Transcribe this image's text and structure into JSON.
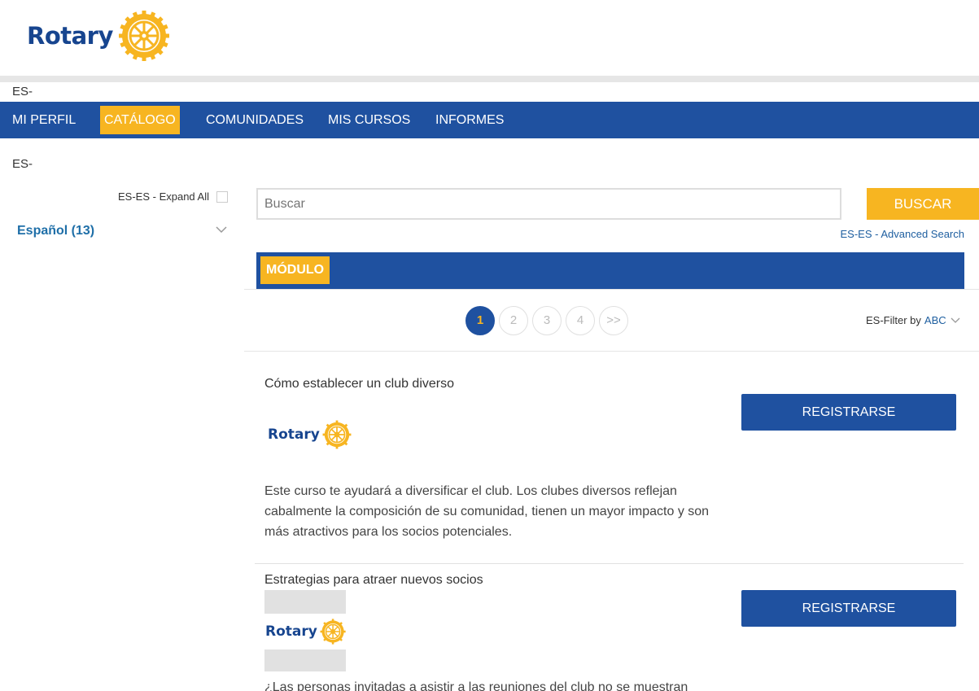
{
  "brand": {
    "logo_text": "Rotary",
    "colors": {
      "blue": "#1f51a0",
      "gold": "#f7b521",
      "logo_blue": "#17458f"
    }
  },
  "locale_label_1": "ES-",
  "locale_label_2": "ES-",
  "nav": {
    "items": [
      {
        "label": "MI PERFIL",
        "active": false
      },
      {
        "label": "CATÁLOGO",
        "active": true
      },
      {
        "label": "COMUNIDADES",
        "active": false
      },
      {
        "label": "MIS CURSOS",
        "active": false
      },
      {
        "label": "INFORMES",
        "active": false
      }
    ]
  },
  "sidebar": {
    "expand_all_label": "ES-ES - Expand All",
    "facet_label": "Español (13)"
  },
  "search": {
    "placeholder": "Buscar",
    "button_label": "BUSCAR",
    "advanced_label": "ES-ES - Advanced Search"
  },
  "module_tab": "MÓDULO",
  "pagination": {
    "pages": [
      "1",
      "2",
      "3",
      "4",
      ">>"
    ],
    "current": "1"
  },
  "filter": {
    "label": "ES-Filter by",
    "value": "ABC"
  },
  "courses": [
    {
      "title": "Cómo establecer un club diverso",
      "logo_text": "Rotary",
      "description": "Este curso te ayudará a diversificar el club. Los clubes diversos reflejan cabalmente la composición de su comunidad, tienen un mayor impacto y son más atractivos para los socios potenciales.",
      "button_label": "REGISTRARSE"
    },
    {
      "title": "Estrategias para atraer nuevos socios",
      "logo_text": "Rotary",
      "description": "¿Las personas invitadas a asistir a las reuniones del club no se muestran",
      "button_label": "REGISTRARSE"
    }
  ]
}
